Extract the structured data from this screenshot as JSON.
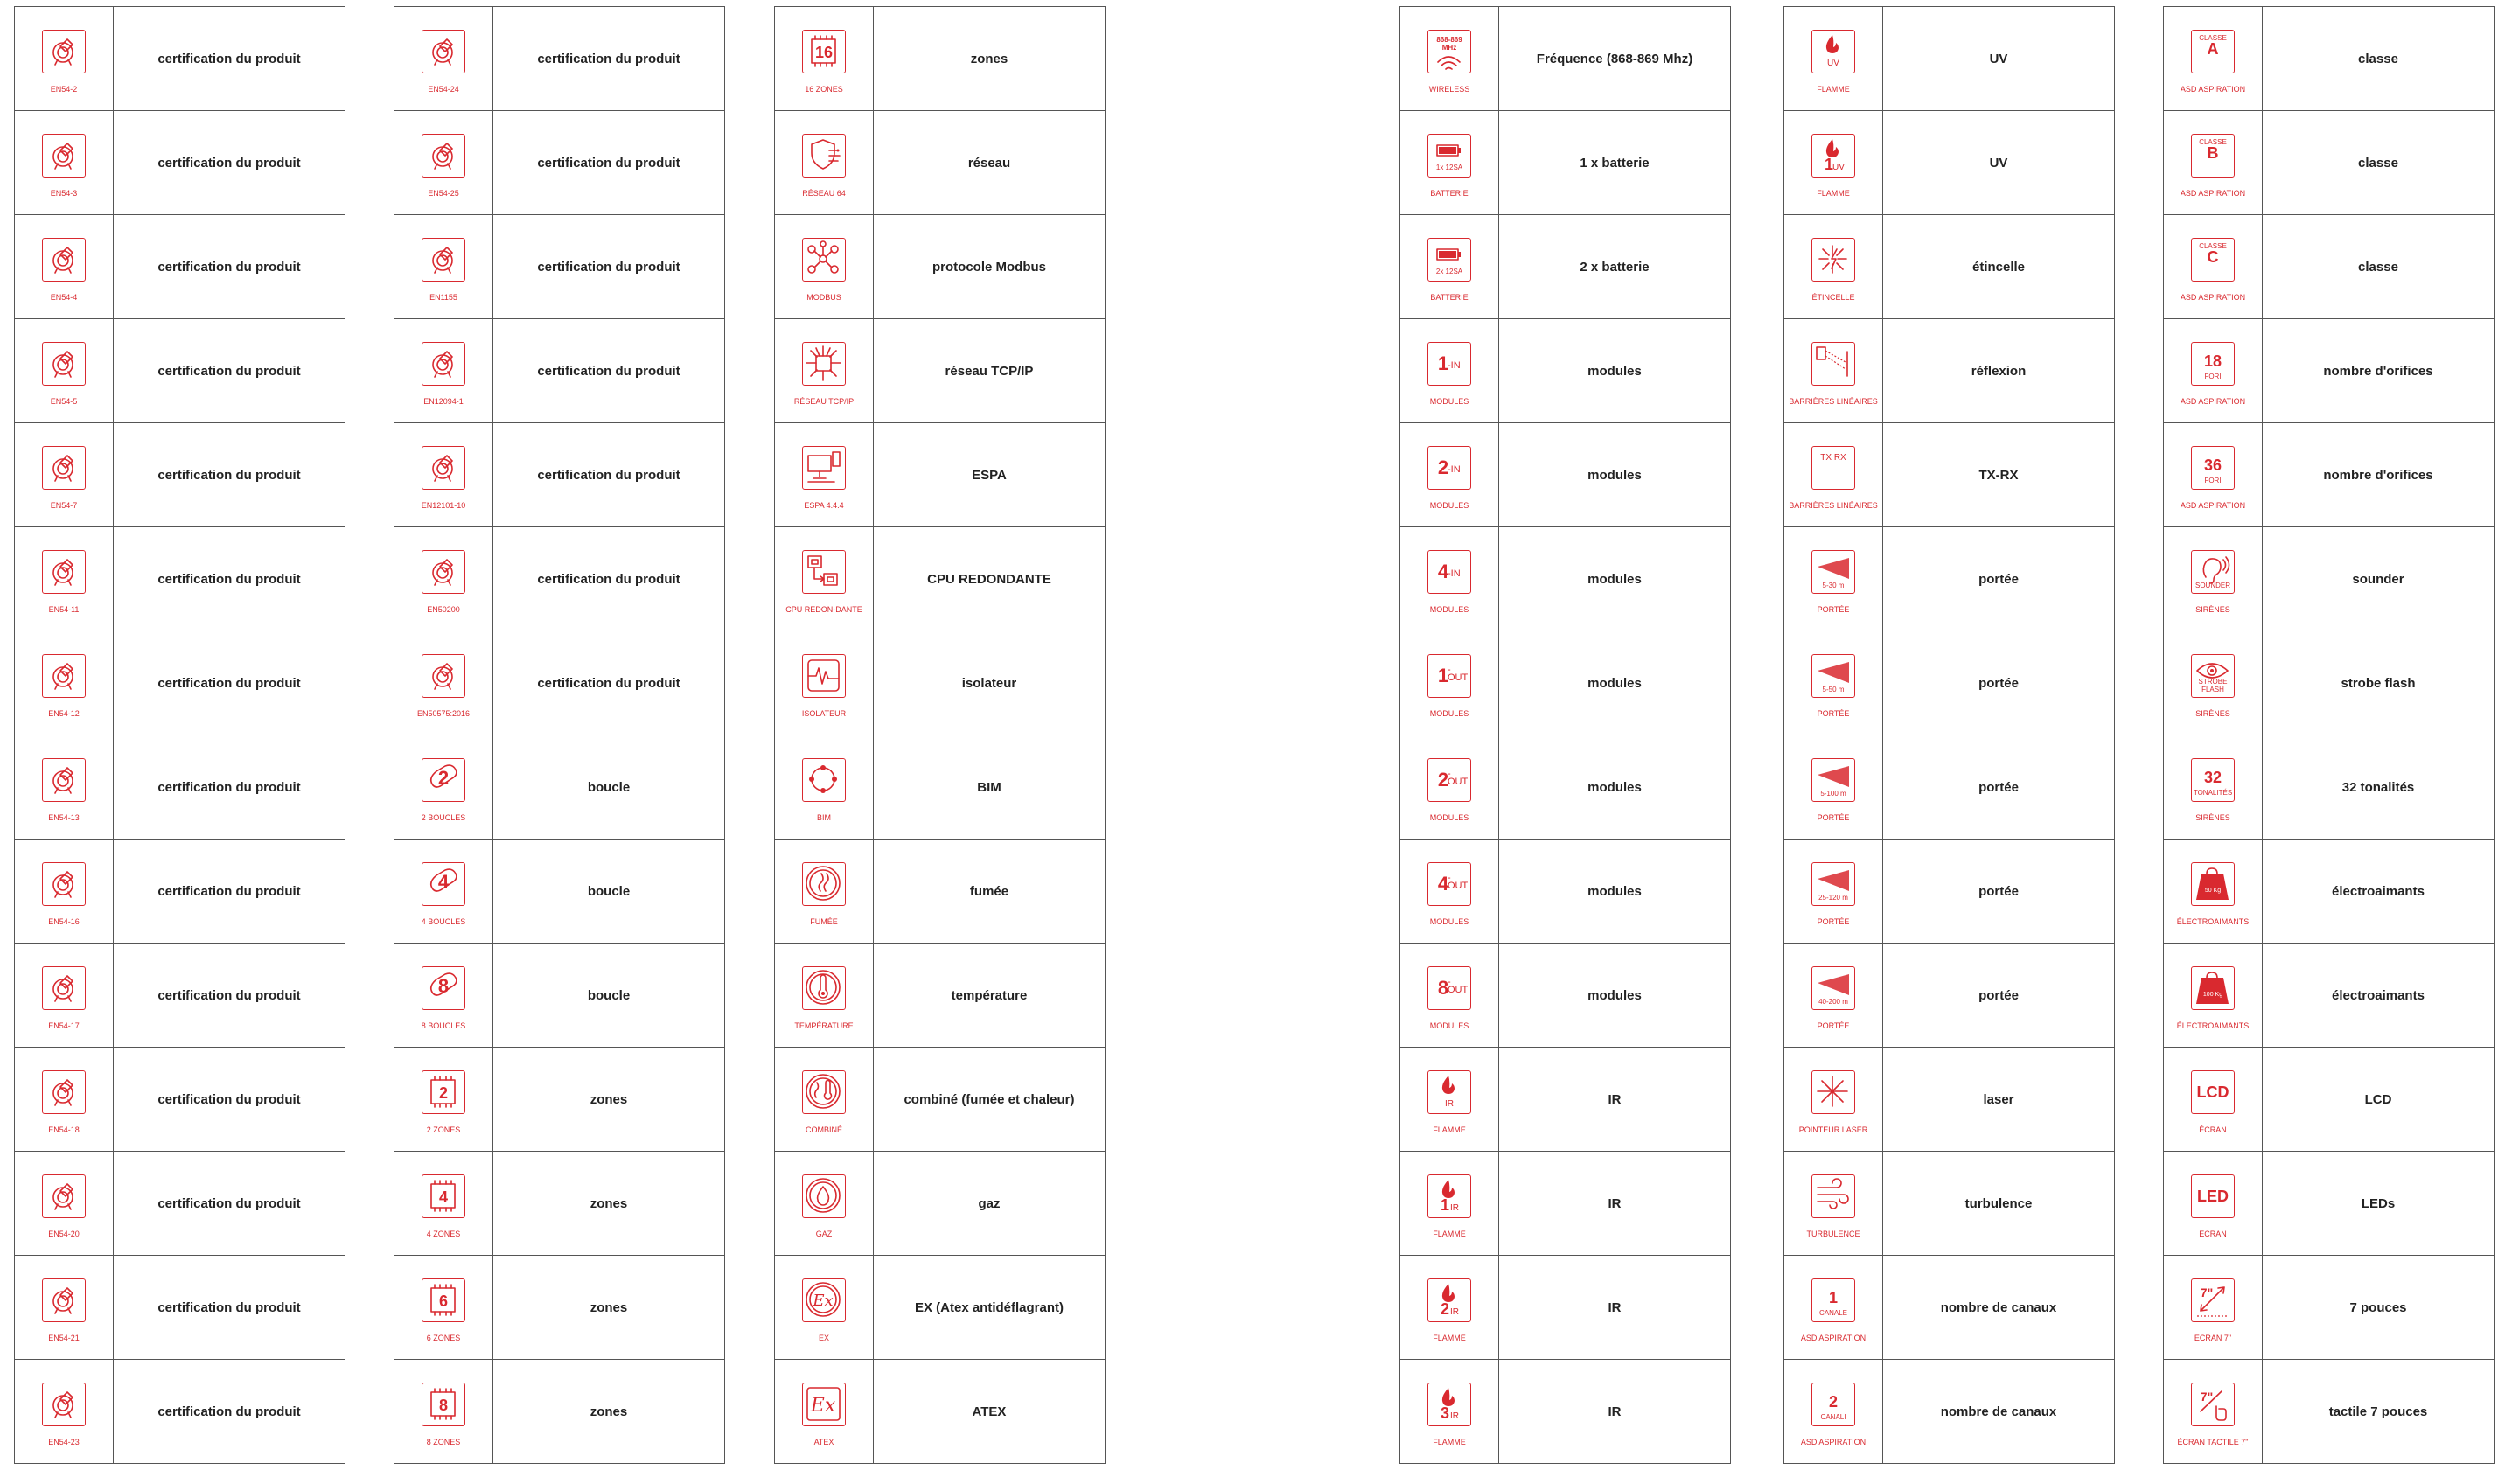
{
  "tables": [
    {
      "rows": [
        {
          "icon": "certification-icon",
          "big": "",
          "small": "",
          "caption": "EN54-2",
          "desc": "certification du produit"
        },
        {
          "icon": "certification-icon",
          "big": "",
          "small": "",
          "caption": "EN54-3",
          "desc": "certification du produit"
        },
        {
          "icon": "certification-icon",
          "big": "",
          "small": "",
          "caption": "EN54-4",
          "desc": "certification du produit"
        },
        {
          "icon": "certification-icon",
          "big": "",
          "small": "",
          "caption": "EN54-5",
          "desc": "certification du produit"
        },
        {
          "icon": "certification-icon",
          "big": "",
          "small": "",
          "caption": "EN54-7",
          "desc": "certification du produit"
        },
        {
          "icon": "certification-icon",
          "big": "",
          "small": "",
          "caption": "EN54-11",
          "desc": "certification du produit"
        },
        {
          "icon": "certification-icon",
          "big": "",
          "small": "",
          "caption": "EN54-12",
          "desc": "certification du produit"
        },
        {
          "icon": "certification-icon",
          "big": "",
          "small": "",
          "caption": "EN54-13",
          "desc": "certification du produit"
        },
        {
          "icon": "certification-icon",
          "big": "",
          "small": "",
          "caption": "EN54-16",
          "desc": "certification du produit"
        },
        {
          "icon": "certification-icon",
          "big": "",
          "small": "",
          "caption": "EN54-17",
          "desc": "certification du produit"
        },
        {
          "icon": "certification-icon",
          "big": "",
          "small": "",
          "caption": "EN54-18",
          "desc": "certification du produit"
        },
        {
          "icon": "certification-icon",
          "big": "",
          "small": "",
          "caption": "EN54-20",
          "desc": "certification du produit"
        },
        {
          "icon": "certification-icon",
          "big": "",
          "small": "",
          "caption": "EN54-21",
          "desc": "certification du produit"
        },
        {
          "icon": "certification-icon",
          "big": "",
          "small": "",
          "caption": "EN54-23",
          "desc": "certification du produit"
        }
      ]
    },
    {
      "rows": [
        {
          "icon": "certification-icon",
          "big": "",
          "small": "",
          "caption": "EN54-24",
          "desc": "certification du produit"
        },
        {
          "icon": "certification-icon",
          "big": "",
          "small": "",
          "caption": "EN54-25",
          "desc": "certification du produit"
        },
        {
          "icon": "certification-icon",
          "big": "",
          "small": "",
          "caption": "EN1155",
          "desc": "certification du produit"
        },
        {
          "icon": "certification-icon",
          "big": "",
          "small": "",
          "caption": "EN12094-1",
          "desc": "certification du produit"
        },
        {
          "icon": "certification-icon",
          "big": "",
          "small": "",
          "caption": "EN12101-10",
          "desc": "certification du produit"
        },
        {
          "icon": "certification-icon",
          "big": "",
          "small": "",
          "caption": "EN50200",
          "desc": "certification du produit"
        },
        {
          "icon": "certification-icon",
          "big": "",
          "small": "",
          "caption": "EN50575:2016",
          "desc": "certification du produit"
        },
        {
          "icon": "loop-icon",
          "big": "2",
          "small": "",
          "caption": "2 BOUCLES",
          "desc": "boucle"
        },
        {
          "icon": "loop-icon",
          "big": "4",
          "small": "",
          "caption": "4 BOUCLES",
          "desc": "boucle"
        },
        {
          "icon": "loop-icon",
          "big": "8",
          "small": "",
          "caption": "8 BOUCLES",
          "desc": "boucle"
        },
        {
          "icon": "zone-chip-icon",
          "big": "2",
          "small": "",
          "caption": "2 ZONES",
          "desc": "zones"
        },
        {
          "icon": "zone-chip-icon",
          "big": "4",
          "small": "",
          "caption": "4 ZONES",
          "desc": "zones"
        },
        {
          "icon": "zone-chip-icon",
          "big": "6",
          "small": "",
          "caption": "6 ZONES",
          "desc": "zones"
        },
        {
          "icon": "zone-chip-icon",
          "big": "8",
          "small": "",
          "caption": "8 ZONES",
          "desc": "zones"
        }
      ]
    },
    {
      "rows": [
        {
          "icon": "zone-chip-icon",
          "big": "16",
          "small": "",
          "caption": "16 ZONES",
          "desc": "zones"
        },
        {
          "icon": "network-shield-icon",
          "big": "",
          "small": "",
          "caption": "RÉSEAU 64",
          "desc": "réseau"
        },
        {
          "icon": "modbus-icon",
          "big": "",
          "small": "",
          "caption": "MODBUS",
          "desc": "protocole Modbus"
        },
        {
          "icon": "tcpip-chip-icon",
          "big": "",
          "small": "",
          "caption": "RÉSEAU TCP/IP",
          "desc": "réseau TCP/IP"
        },
        {
          "icon": "computer-icon",
          "big": "",
          "small": "",
          "caption": "ESPA 4.4.4",
          "desc": "ESPA"
        },
        {
          "icon": "redundant-cpu-icon",
          "big": "",
          "small": "",
          "caption": "CPU REDON-DANTE",
          "desc": "CPU REDONDANTE"
        },
        {
          "icon": "isolator-icon",
          "big": "",
          "small": "",
          "caption": "ISOLATEUR",
          "desc": "isolateur"
        },
        {
          "icon": "bim-icon",
          "big": "",
          "small": "",
          "caption": "BIM",
          "desc": "BIM"
        },
        {
          "icon": "smoke-icon",
          "big": "",
          "small": "",
          "caption": "FUMÉE",
          "desc": "fumée"
        },
        {
          "icon": "thermometer-icon",
          "big": "",
          "small": "",
          "caption": "TEMPÉRATURE",
          "desc": "température"
        },
        {
          "icon": "combined-icon",
          "big": "",
          "small": "",
          "caption": "COMBINÉ",
          "desc": "combiné (fumée et chaleur)"
        },
        {
          "icon": "gas-drop-icon",
          "big": "",
          "small": "",
          "caption": "GAZ",
          "desc": "gaz"
        },
        {
          "icon": "ex-circle-icon",
          "big": "",
          "small": "",
          "caption": "EX",
          "desc": "EX (Atex antidéflagrant)"
        },
        {
          "icon": "atex-icon",
          "big": "",
          "small": "",
          "caption": "ATEX",
          "desc": "ATEX"
        }
      ]
    },
    {
      "rows": [
        {
          "icon": "wireless-icon",
          "big": "",
          "small": "868-869 MHz",
          "caption": "WIRELESS",
          "desc": "Fréquence (868-869 Mhz)"
        },
        {
          "icon": "battery-icon",
          "big": "",
          "small": "1x 12SA",
          "caption": "BATTERIE",
          "desc": "1 x batterie"
        },
        {
          "icon": "battery-icon",
          "big": "",
          "small": "2x 12SA",
          "caption": "BATTERIE",
          "desc": "2 x batterie"
        },
        {
          "icon": "module-icon",
          "big": "1",
          "small": "-IN",
          "caption": "MODULES",
          "desc": "modules"
        },
        {
          "icon": "module-icon",
          "big": "2",
          "small": "-IN",
          "caption": "MODULES",
          "desc": "modules"
        },
        {
          "icon": "module-icon",
          "big": "4",
          "small": "-IN",
          "caption": "MODULES",
          "desc": "modules"
        },
        {
          "icon": "module-icon",
          "big": "1",
          "small": "-OUT",
          "caption": "MODULES",
          "desc": "modules"
        },
        {
          "icon": "module-icon",
          "big": "2",
          "small": "-OUT",
          "caption": "MODULES",
          "desc": "modules"
        },
        {
          "icon": "module-icon",
          "big": "4",
          "small": "-OUT",
          "caption": "MODULES",
          "desc": "modules"
        },
        {
          "icon": "module-icon",
          "big": "8",
          "small": "-OUT",
          "caption": "MODULES",
          "desc": "modules"
        },
        {
          "icon": "flame-icon",
          "big": "",
          "small": "IR",
          "caption": "FLAMME",
          "desc": "IR"
        },
        {
          "icon": "flame-icon",
          "big": "1",
          "small": "IR",
          "caption": "FLAMME",
          "desc": "IR"
        },
        {
          "icon": "flame-icon",
          "big": "2",
          "small": "IR",
          "caption": "FLAMME",
          "desc": "IR"
        },
        {
          "icon": "flame-icon",
          "big": "3",
          "small": "IR",
          "caption": "FLAMME",
          "desc": "IR"
        }
      ]
    },
    {
      "rows": [
        {
          "icon": "flame-icon",
          "big": "",
          "small": "UV",
          "caption": "FLAMME",
          "desc": "UV"
        },
        {
          "icon": "flame-icon",
          "big": "1",
          "small": "UV",
          "caption": "FLAMME",
          "desc": "UV"
        },
        {
          "icon": "spark-icon",
          "big": "",
          "small": "",
          "caption": "ÉTINCELLE",
          "desc": "étincelle"
        },
        {
          "icon": "beam-reflection-icon",
          "big": "",
          "small": "",
          "caption": "BARRIÈRES LINÉAIRES",
          "desc": "réflexion"
        },
        {
          "icon": "beam-txrx-icon",
          "big": "",
          "small": "TX RX",
          "caption": "BARRIÈRES LINÉAIRES",
          "desc": "TX-RX"
        },
        {
          "icon": "range-icon",
          "big": "",
          "small": "5-30 m",
          "caption": "PORTÉE",
          "desc": "portée"
        },
        {
          "icon": "range-icon",
          "big": "",
          "small": "5-50 m",
          "caption": "PORTÉE",
          "desc": "portée"
        },
        {
          "icon": "range-icon",
          "big": "",
          "small": "5-100 m",
          "caption": "PORTÉE",
          "desc": "portée"
        },
        {
          "icon": "range-icon",
          "big": "",
          "small": "25-120 m",
          "caption": "PORTÉE",
          "desc": "portée"
        },
        {
          "icon": "range-icon",
          "big": "",
          "small": "40-200 m",
          "caption": "PORTÉE",
          "desc": "portée"
        },
        {
          "icon": "laser-icon",
          "big": "",
          "small": "",
          "caption": "POINTEUR LASER",
          "desc": "laser"
        },
        {
          "icon": "turbulence-icon",
          "big": "",
          "small": "",
          "caption": "TURBULENCE",
          "desc": "turbulence"
        },
        {
          "icon": "channel-icon",
          "big": "1",
          "small": "CANALE",
          "caption": "ASD ASPIRATION",
          "desc": "nombre de canaux"
        },
        {
          "icon": "channel-icon",
          "big": "2",
          "small": "CANALI",
          "caption": "ASD ASPIRATION",
          "desc": "nombre de canaux"
        }
      ]
    },
    {
      "rows": [
        {
          "icon": "class-icon",
          "big": "A",
          "small": "CLASSE",
          "caption": "ASD ASPIRATION",
          "desc": "classe"
        },
        {
          "icon": "class-icon",
          "big": "B",
          "small": "CLASSE",
          "caption": "ASD ASPIRATION",
          "desc": "classe"
        },
        {
          "icon": "class-icon",
          "big": "C",
          "small": "CLASSE",
          "caption": "ASD ASPIRATION",
          "desc": "classe"
        },
        {
          "icon": "holes-icon",
          "big": "18",
          "small": "FORI",
          "caption": "ASD ASPIRATION",
          "desc": "nombre d'orifices"
        },
        {
          "icon": "holes-icon",
          "big": "36",
          "small": "FORI",
          "caption": "ASD ASPIRATION",
          "desc": "nombre d'orifices"
        },
        {
          "icon": "ear-icon",
          "big": "",
          "small": "SOUNDER",
          "caption": "SIRÈNES",
          "desc": "sounder"
        },
        {
          "icon": "eye-icon",
          "big": "",
          "small": "STROBE FLASH",
          "caption": "SIRÈNES",
          "desc": "strobe flash"
        },
        {
          "icon": "tones-icon",
          "big": "32",
          "small": "TONALITÉS",
          "caption": "SIRÈNES",
          "desc": "32 tonalités"
        },
        {
          "icon": "weight-icon",
          "big": "",
          "small": "50 Kg",
          "caption": "ÉLECTROAIMANTS",
          "desc": "électroaimants"
        },
        {
          "icon": "weight-icon",
          "big": "",
          "small": "100 Kg",
          "caption": "ÉLECTROAIMANTS",
          "desc": "électroaimants"
        },
        {
          "icon": "screen-text-icon",
          "big": "LCD",
          "small": "",
          "caption": "ÉCRAN",
          "desc": "LCD"
        },
        {
          "icon": "screen-text-icon",
          "big": "LED",
          "small": "",
          "caption": "ÉCRAN",
          "desc": "LEDs"
        },
        {
          "icon": "screen-size-icon",
          "big": "7\"",
          "small": "",
          "caption": "ÉCRAN 7\"",
          "desc": "7 pouces"
        },
        {
          "icon": "touch-screen-icon",
          "big": "7\"",
          "small": "",
          "caption": "ÉCRAN TACTILE 7\"",
          "desc": "tactile 7 pouces"
        }
      ]
    }
  ],
  "colors": {
    "accent": "#d9292f",
    "border": "#555555",
    "text": "#222222"
  }
}
